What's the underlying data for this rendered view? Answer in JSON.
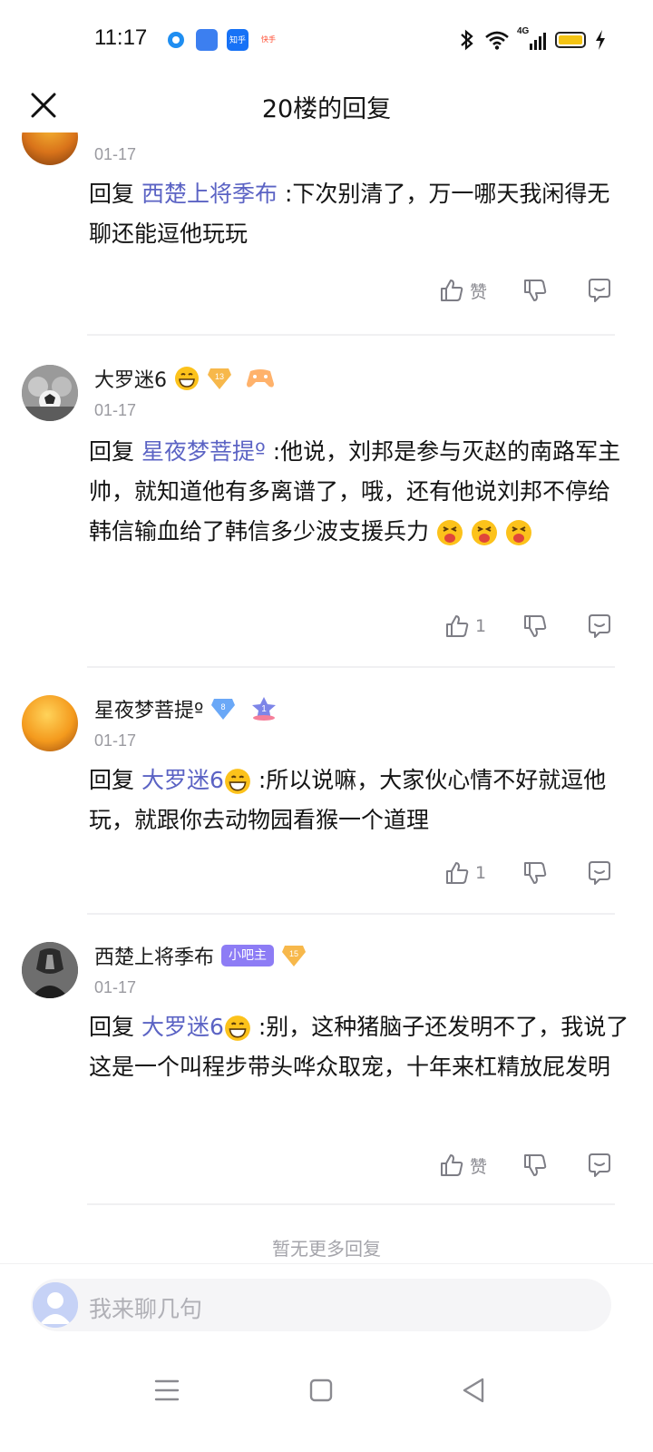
{
  "status_bar": {
    "time": "11:17",
    "notif_labels": [
      "知乎",
      "快手"
    ],
    "network": "4G",
    "battery_color": "#f4c414"
  },
  "header": {
    "title": "20楼的回复",
    "close_icon": "close-icon"
  },
  "replies": [
    {
      "username": "",
      "date": "01-17",
      "reply_prefix": "回复",
      "mention": "西楚上将季布",
      "text": ":下次别清了，万一哪天我闲得无聊还能逗他玩玩",
      "like_label": "赞",
      "like_count": ""
    },
    {
      "username": "大罗迷6",
      "level": "13",
      "date": "01-17",
      "reply_prefix": "回复",
      "mention": "星夜梦菩提º",
      "text": ":他说，刘邦是参与灭赵的南路军主帅，就知道他有多离谱了，哦，还有他说刘邦不停给韩信输血给了韩信多少波支援兵力",
      "like_label": "",
      "like_count": "1"
    },
    {
      "username": "星夜梦菩提º",
      "level": "8",
      "rank": "1",
      "date": "01-17",
      "reply_prefix": "回复",
      "mention": "大罗迷6",
      "text": ":所以说嘛，大家伙心情不好就逗他玩，就跟你去动物园看猴一个道理",
      "like_label": "",
      "like_count": "1"
    },
    {
      "username": "西楚上将季布",
      "mod_badge": "小吧主",
      "level": "15",
      "date": "01-17",
      "reply_prefix": "回复",
      "mention": "大罗迷6",
      "text": ":别，这种猪脑子还发明不了，我说了这是一个叫程步带头哗众取宠，十年来杠精放屁发明",
      "like_label": "赞",
      "like_count": ""
    }
  ],
  "footer": {
    "no_more": "暂无更多回复",
    "input_placeholder": "我来聊几句"
  },
  "colors": {
    "mention": "#5b63c4",
    "mod_badge": "#8d7cf5",
    "level_badge": "#f7b84b"
  }
}
